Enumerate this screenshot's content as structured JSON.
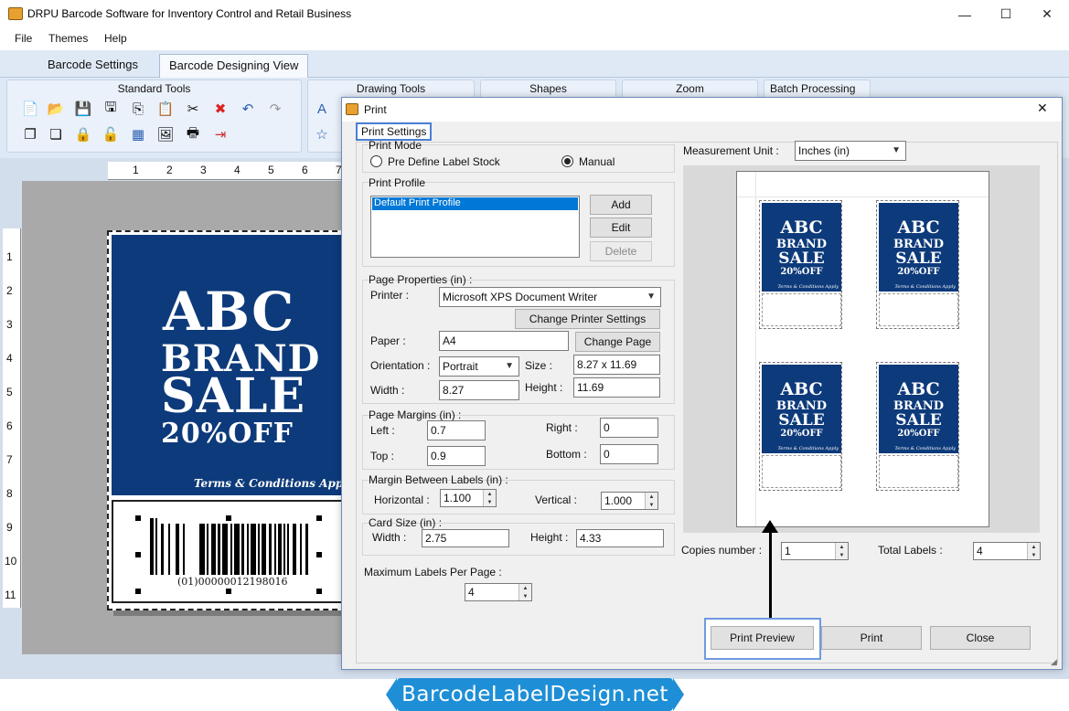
{
  "window": {
    "title": "DRPU Barcode Software for Inventory Control and Retail Business",
    "minimize": "—",
    "maximize": "☐",
    "close": "✕"
  },
  "menu": [
    "File",
    "Themes",
    "Help"
  ],
  "tabs": [
    "Barcode Settings",
    "Barcode Designing View"
  ],
  "ribbon": {
    "groups": [
      "Standard Tools",
      "Drawing Tools",
      "Shapes",
      "Zoom",
      "Batch Processing"
    ]
  },
  "ruler": {
    "top": [
      "1",
      "2",
      "3",
      "4",
      "5",
      "6",
      "7"
    ],
    "left": [
      "1",
      "2",
      "3",
      "4",
      "5",
      "6",
      "7",
      "8",
      "9",
      "10",
      "11"
    ]
  },
  "label": {
    "line1": "ABC",
    "line2": "BRAND",
    "line3": "SALE",
    "line4": "20%OFF",
    "terms": "Terms & Conditions Apply",
    "barcode_text": "(01)00000012198016",
    "colors": {
      "background": "#0d3a7a",
      "text": "#ffffff"
    }
  },
  "dialog": {
    "title": "Print",
    "close": "✕",
    "tab": "Print Settings",
    "print_mode": {
      "legend": "Print Mode",
      "option_predefine": "Pre Define Label Stock",
      "option_manual": "Manual",
      "selected": "Manual"
    },
    "print_profile": {
      "legend": "Print Profile",
      "items": [
        "Default Print Profile"
      ],
      "add": "Add",
      "edit": "Edit",
      "delete": "Delete"
    },
    "page_properties": {
      "legend": "Page Properties (in) :",
      "printer_label": "Printer :",
      "printer_value": "Microsoft XPS Document Writer",
      "change_printer": "Change Printer Settings",
      "paper_label": "Paper :",
      "paper_value": "A4",
      "change_page": "Change Page",
      "orientation_label": "Orientation :",
      "orientation_value": "Portrait",
      "size_label": "Size :",
      "size_value": "8.27 x 11.69",
      "width_label": "Width :",
      "width_value": "8.27",
      "height_label": "Height :",
      "height_value": "11.69"
    },
    "page_margins": {
      "legend": "Page Margins (in) :",
      "left_label": "Left :",
      "left_value": "0.7",
      "right_label": "Right :",
      "right_value": "0",
      "top_label": "Top :",
      "top_value": "0.9",
      "bottom_label": "Bottom :",
      "bottom_value": "0"
    },
    "margin_between": {
      "legend": "Margin Between Labels (in) :",
      "horizontal_label": "Horizontal :",
      "horizontal_value": "1.100",
      "vertical_label": "Vertical :",
      "vertical_value": "1.000"
    },
    "card_size": {
      "legend": "Card Size (in) :",
      "width_label": "Width :",
      "width_value": "2.75",
      "height_label": "Height :",
      "height_value": "4.33"
    },
    "max_labels": {
      "label": "Maximum Labels Per Page :",
      "value": "4"
    },
    "measurement": {
      "label": "Measurement Unit :",
      "value": "Inches (in)"
    },
    "copies": {
      "label": "Copies number :",
      "value": "1"
    },
    "total_labels": {
      "label": "Total Labels :",
      "value": "4"
    },
    "buttons": {
      "preview": "Print Preview",
      "print": "Print",
      "close": "Close"
    },
    "preview_label": {
      "line1": "ABC",
      "line2": "BRAND",
      "line3": "SALE",
      "line4": "20%OFF",
      "terms": "Terms & Conditions Apply"
    }
  },
  "watermark": "BarcodeLabelDesign.net",
  "accent_colors": {
    "highlight_border": "#4a7fd6",
    "watermark_bg": "#1e8fd6"
  }
}
